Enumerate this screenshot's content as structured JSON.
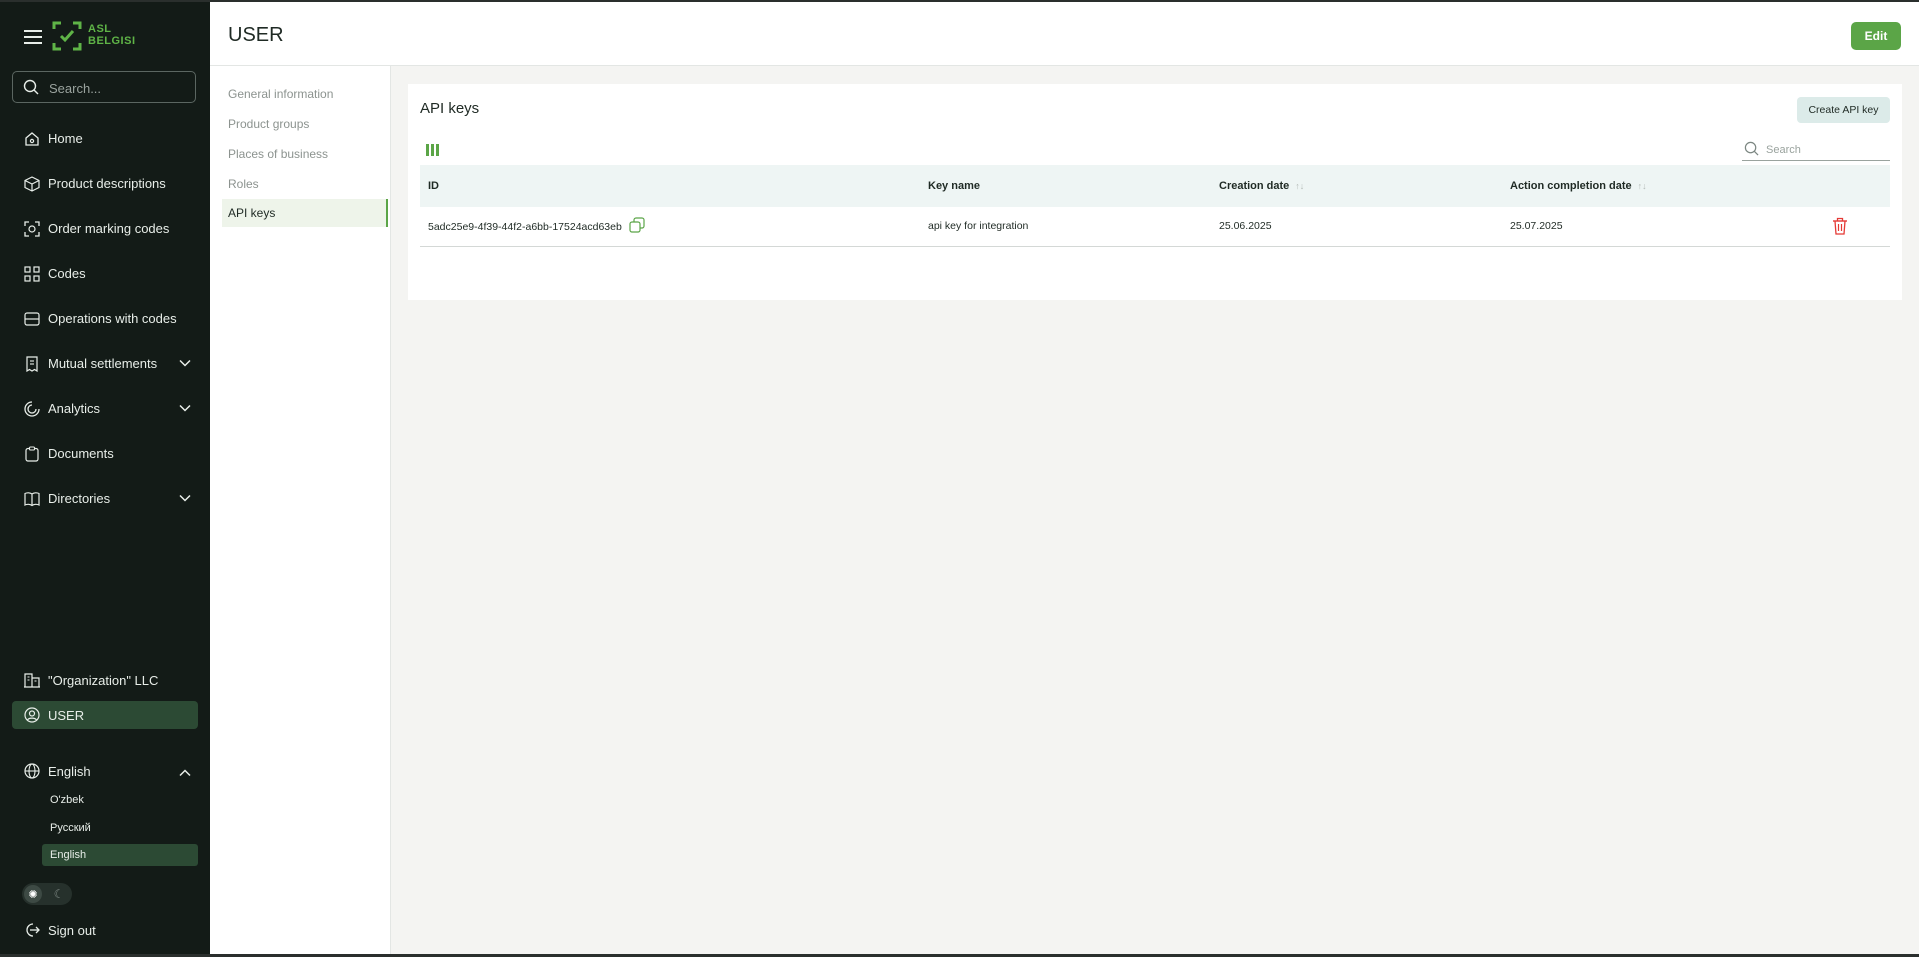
{
  "brand": {
    "logo_line1": "ASL",
    "logo_line2": "BELGISI"
  },
  "sidebar": {
    "search_placeholder": "Search...",
    "items": [
      {
        "label": "Home",
        "icon": "home-icon"
      },
      {
        "label": "Product descriptions",
        "icon": "box-icon"
      },
      {
        "label": "Order marking codes",
        "icon": "scan-icon"
      },
      {
        "label": "Codes",
        "icon": "code-grid-icon"
      },
      {
        "label": "Operations with codes",
        "icon": "stack-icon"
      },
      {
        "label": "Mutual settlements",
        "icon": "receipt-icon",
        "expandable": true
      },
      {
        "label": "Analytics",
        "icon": "chart-icon",
        "expandable": true
      },
      {
        "label": "Documents",
        "icon": "clipboard-icon"
      },
      {
        "label": "Directories",
        "icon": "book-icon",
        "expandable": true
      }
    ],
    "organization": "\"Organization\" LLC",
    "user": "USER",
    "language": {
      "current": "English",
      "options": [
        "O'zbek",
        "Русский",
        "English"
      ],
      "selected": "English"
    },
    "theme_sun": "✺",
    "theme_moon": "☾",
    "sign_out": "Sign out"
  },
  "header": {
    "title": "USER",
    "edit_label": "Edit"
  },
  "subnav": {
    "items": [
      "General information",
      "Product groups",
      "Places of business",
      "Roles",
      "API keys"
    ],
    "active": "API keys"
  },
  "panel": {
    "title": "API keys",
    "create_label": "Create API key",
    "search_placeholder": "Search",
    "columns": {
      "id": "ID",
      "key_name": "Key name",
      "creation_date": "Creation date",
      "completion_date": "Action completion date",
      "sort_glyph": "↑↓"
    },
    "rows": [
      {
        "id": "5adc25e9-4f39-44f2-a6bb-17524acd63eb",
        "key_name": "api key for integration",
        "creation_date": "25.06.2025",
        "completion_date": "25.07.2025"
      }
    ]
  },
  "colors": {
    "sidebar_bg": "#131b17",
    "accent_green": "#5ba547",
    "active_item_bg": "#2c4a34",
    "delete_red": "#e53935",
    "table_header_bg": "#eef5f4"
  }
}
